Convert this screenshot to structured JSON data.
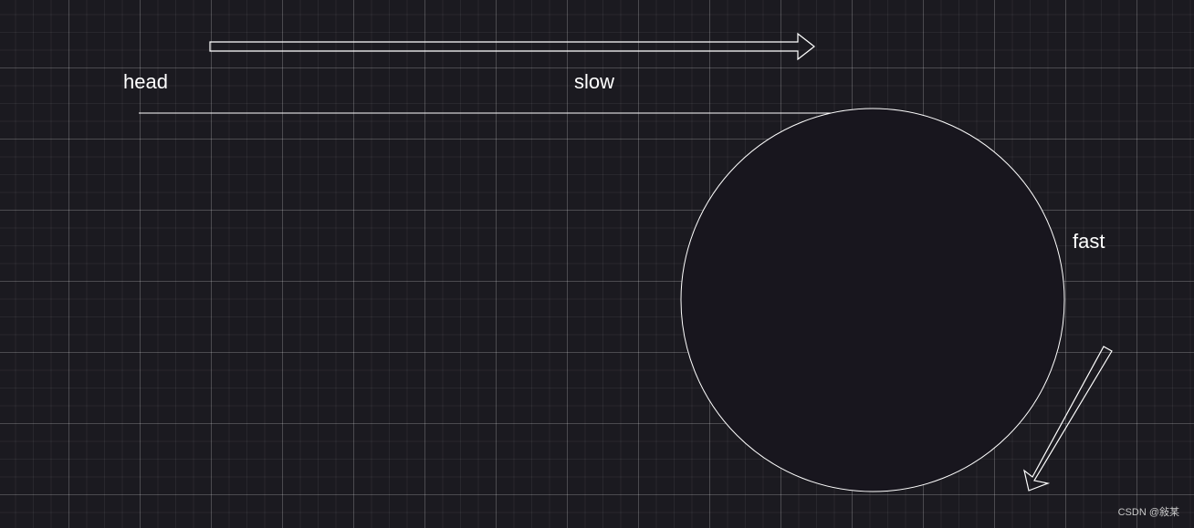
{
  "labels": {
    "head": "head",
    "slow": "slow",
    "fast": "fast"
  },
  "watermark": "CSDN @敍某",
  "colors": {
    "background": "#1b1a20",
    "stroke": "#ffffff",
    "text": "#ffffff"
  }
}
